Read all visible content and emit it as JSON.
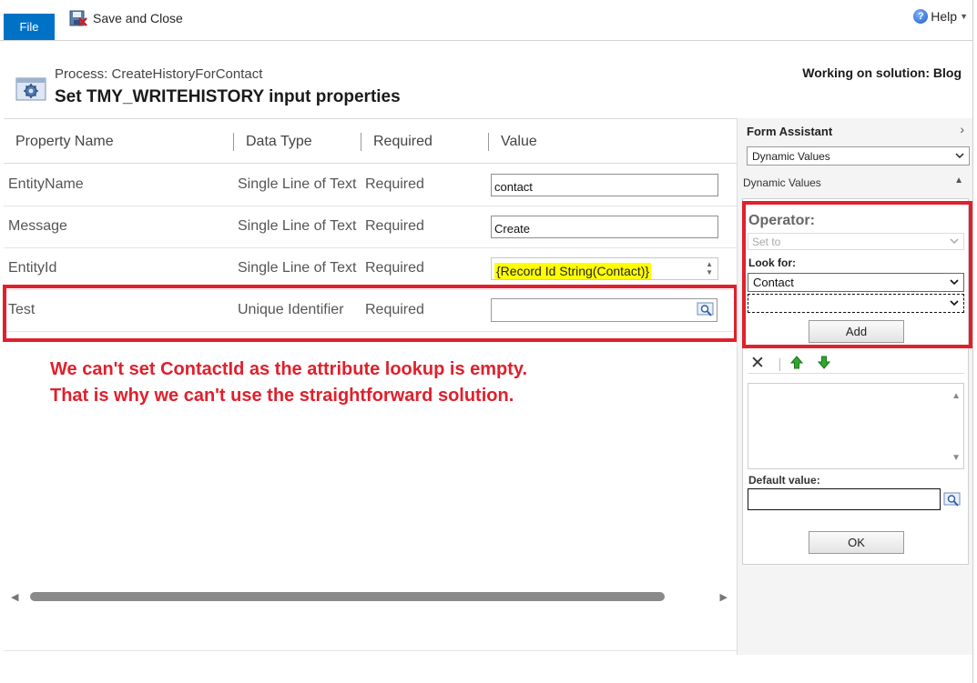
{
  "ribbon": {
    "file_label": "File",
    "save_close_label": "Save and Close",
    "help_label": "Help"
  },
  "header": {
    "process_label": "Process: CreateHistoryForContact",
    "title": "Set TMY_WRITEHISTORY input properties",
    "solution": "Working on solution: Blog"
  },
  "grid": {
    "columns": [
      "Property Name",
      "Data Type",
      "Required",
      "Value"
    ],
    "rows": [
      {
        "name": "EntityName",
        "type": "Single Line of Text",
        "required": "Required",
        "value": "contact"
      },
      {
        "name": "Message",
        "type": "Single Line of Text",
        "required": "Required",
        "value": "Create"
      },
      {
        "name": "EntityId",
        "type": "Single Line of Text",
        "required": "Required",
        "value": "{Record Id String(Contact)}"
      },
      {
        "name": "Test",
        "type": "Unique Identifier",
        "required": "Required",
        "value": ""
      }
    ]
  },
  "annotation": "We can't set ContactId as the attribute lookup is empty. That is why we can't use the straightforward solution.",
  "form_assistant": {
    "title": "Form Assistant",
    "mode_select": "Dynamic Values",
    "section_label": "Dynamic Values",
    "operator_label": "Operator:",
    "operator_value": "Set to",
    "look_for_label": "Look for:",
    "look_for_value": "Contact",
    "attribute_value": "",
    "add_label": "Add",
    "default_value_label": "Default value:",
    "ok_label": "OK"
  },
  "colors": {
    "accent": "#0072c6",
    "annotation_red": "#e0202c",
    "highlight": "#ffff00"
  },
  "icons": [
    "save-close-icon",
    "help-icon",
    "process-icon",
    "lookup-icon",
    "delete-icon",
    "move-up-icon",
    "move-down-icon"
  ]
}
